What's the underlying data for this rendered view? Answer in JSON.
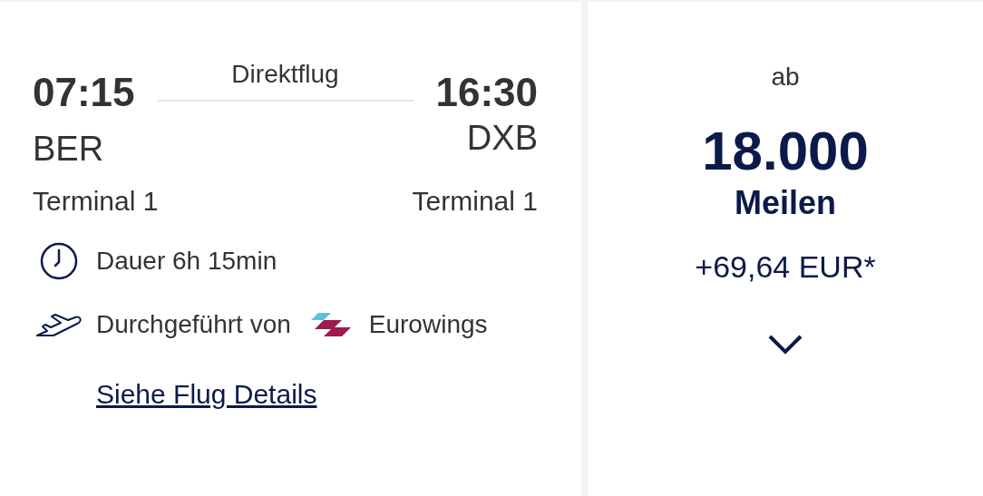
{
  "flight": {
    "departure": {
      "time": "07:15",
      "airport": "BER",
      "terminal": "Terminal 1"
    },
    "arrival": {
      "time": "16:30",
      "airport": "DXB",
      "terminal": "Terminal 1"
    },
    "stops": "Direktflug",
    "duration": "Dauer 6h 15min",
    "operated_by": "Durchgeführt von",
    "airline": "Eurowings",
    "details_link": "Siehe Flug Details"
  },
  "price": {
    "prefix": "ab",
    "miles": "18.000",
    "unit": "Meilen",
    "surcharge": "+69,64 EUR*",
    "expanded": false
  }
}
